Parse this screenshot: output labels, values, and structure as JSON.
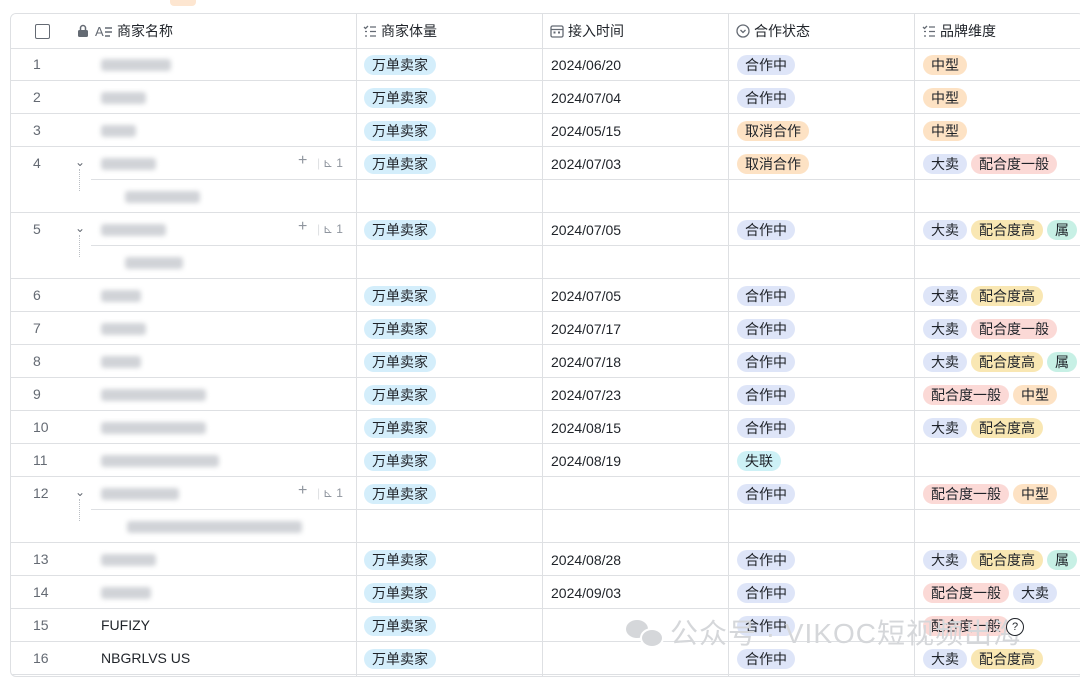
{
  "columns": {
    "name": "商家名称",
    "volume": "商家体量",
    "time": "接入时间",
    "status": "合作状态",
    "brand": "品牌维度"
  },
  "rows": [
    {
      "n": "1",
      "vol": "万单卖家",
      "date": "2024/06/20",
      "status": "合作中",
      "tags": [
        "中型"
      ]
    },
    {
      "n": "2",
      "vol": "万单卖家",
      "date": "2024/07/04",
      "status": "合作中",
      "tags": [
        "中型"
      ]
    },
    {
      "n": "3",
      "vol": "万单卖家",
      "date": "2024/05/15",
      "status": "取消合作",
      "tags": [
        "中型"
      ]
    },
    {
      "n": "4",
      "vol": "万单卖家",
      "date": "2024/07/03",
      "status": "取消合作",
      "tags": [
        "大卖",
        "配合度一般"
      ],
      "sub": "1"
    },
    {
      "n": "5",
      "vol": "万单卖家",
      "date": "2024/07/05",
      "status": "合作中",
      "tags": [
        "大卖",
        "配合度高",
        "属"
      ],
      "sub": "1"
    },
    {
      "n": "6",
      "vol": "万单卖家",
      "date": "2024/07/05",
      "status": "合作中",
      "tags": [
        "大卖",
        "配合度高"
      ]
    },
    {
      "n": "7",
      "vol": "万单卖家",
      "date": "2024/07/17",
      "status": "合作中",
      "tags": [
        "大卖",
        "配合度一般"
      ]
    },
    {
      "n": "8",
      "vol": "万单卖家",
      "date": "2024/07/18",
      "status": "合作中",
      "tags": [
        "大卖",
        "配合度高",
        "属"
      ]
    },
    {
      "n": "9",
      "vol": "万单卖家",
      "date": "2024/07/23",
      "status": "合作中",
      "tags": [
        "配合度一般",
        "中型"
      ]
    },
    {
      "n": "10",
      "vol": "万单卖家",
      "date": "2024/08/15",
      "status": "合作中",
      "tags": [
        "大卖",
        "配合度高"
      ]
    },
    {
      "n": "11",
      "vol": "万单卖家",
      "date": "2024/08/19",
      "status": "失联",
      "tags": []
    },
    {
      "n": "12",
      "vol": "万单卖家",
      "date": "",
      "status": "合作中",
      "tags": [
        "配合度一般",
        "中型"
      ],
      "sub": "1"
    },
    {
      "n": "13",
      "vol": "万单卖家",
      "date": "2024/08/28",
      "status": "合作中",
      "tags": [
        "大卖",
        "配合度高",
        "属"
      ]
    },
    {
      "n": "14",
      "vol": "万单卖家",
      "date": "2024/09/03",
      "status": "合作中",
      "tags": [
        "配合度一般",
        "大卖"
      ]
    },
    {
      "n": "15",
      "name": "FUFIZY",
      "vol": "万单卖家",
      "date": "",
      "status": "合作中",
      "tags": [
        "配合度一般"
      ]
    },
    {
      "n": "16",
      "name": "NBGRLVS US",
      "vol": "万单卖家",
      "date": "",
      "status": "合作中",
      "tags": [
        "大卖",
        "配合度高"
      ]
    }
  ],
  "watermark": "公众号 · VIKOC短视频出海",
  "colors": {
    "volume": "#d4eefb",
    "status_active": "#dee5f8",
    "status_cancel": "#fde2c4",
    "status_lost": "#cdf1f6",
    "tag_big": "#dee5f8",
    "tag_mid": "#fde2c4",
    "tag_normal": "#fbd9d6",
    "tag_high": "#f9e7b3",
    "tag_extra": "#c7f0e5"
  }
}
